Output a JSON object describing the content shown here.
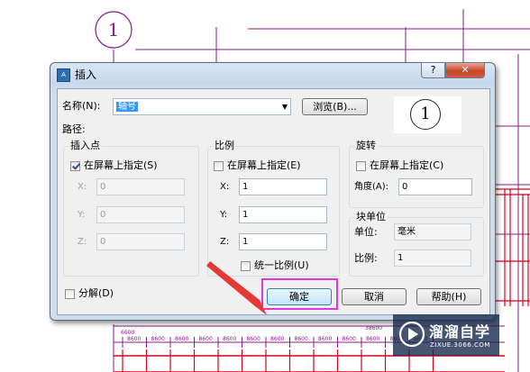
{
  "drawing": {
    "circle_label_top": "1",
    "dims": [
      "8600",
      "8600",
      "8600",
      "8600",
      "8600",
      "8600",
      "8600",
      "8600",
      "8600",
      "8600",
      "8600",
      "8600",
      "8600"
    ],
    "dim_top": "38600",
    "dim_left": "6600"
  },
  "dialog": {
    "title": "插入",
    "help_glyph": "?",
    "close_glyph": "✕",
    "name_label": "名称(N):",
    "name_value": "轴号",
    "browse_label": "浏览(B)...",
    "path_label": "路径:",
    "preview_label": "1",
    "insertion": {
      "title": "插入点",
      "specify_label": "在屏幕上指定(S)",
      "specify_checked": true,
      "x_label": "X:",
      "x_value": "0",
      "y_label": "Y:",
      "y_value": "0",
      "z_label": "Z:",
      "z_value": "0"
    },
    "scale": {
      "title": "比例",
      "specify_label": "在屏幕上指定(E)",
      "specify_checked": false,
      "x_label": "X:",
      "x_value": "1",
      "y_label": "Y:",
      "y_value": "1",
      "z_label": "Z:",
      "z_value": "1",
      "uniform_label": "统一比例(U)",
      "uniform_checked": false
    },
    "rotation": {
      "title": "旋转",
      "specify_label": "在屏幕上指定(C)",
      "specify_checked": false,
      "angle_label": "角度(A):",
      "angle_value": "0"
    },
    "block_unit": {
      "title": "块单位",
      "unit_label": "单位:",
      "unit_value": "毫米",
      "factor_label": "比例:",
      "factor_value": "1"
    },
    "explode_label": "分解(D)",
    "explode_checked": false,
    "ok_label": "确定",
    "cancel_label": "取消",
    "help_label": "帮助(H)"
  },
  "watermark": {
    "brand": "溜溜自学",
    "url": "ZIXUE.3066.COM"
  },
  "colors": {
    "highlight": "#e03ad6",
    "arrow": "#e53935",
    "magenta": "#8c1a8c",
    "red": "#d9001b"
  }
}
